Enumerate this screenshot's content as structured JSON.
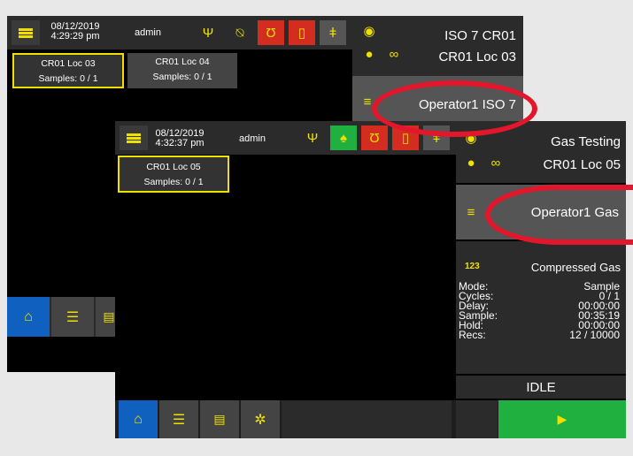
{
  "back_screen": {
    "header": {
      "date": "08/12/2019",
      "time": "4:29:29 pm",
      "user": "admin"
    },
    "locations": [
      {
        "name": "CR01 Loc 03",
        "samples": "Samples: 0 / 1"
      },
      {
        "name": "CR01 Loc 04",
        "samples": "Samples: 0 / 1"
      }
    ],
    "right_panel": {
      "line1": "ISO 7 CR01",
      "line2": "CR01 Loc 03",
      "operator": "Operator1 ISO 7"
    }
  },
  "front_screen": {
    "header": {
      "date": "08/12/2019",
      "time": "4:32:37 pm",
      "user": "admin"
    },
    "locations": [
      {
        "name": "CR01 Loc 05",
        "samples": "Samples: 0 / 1"
      }
    ],
    "right_panel": {
      "line1": "Gas Testing",
      "line2": "CR01 Loc 05",
      "operator": "Operator1 Gas",
      "counter_icon": "123",
      "type": "Compressed Gas",
      "stats": [
        {
          "label": "Mode:",
          "value": "Sample"
        },
        {
          "label": "Cycles:",
          "value": "0 / 1"
        },
        {
          "label": "Delay:",
          "value": "00:00:00"
        },
        {
          "label": "Sample:",
          "value": "00:35:19"
        },
        {
          "label": "Hold:",
          "value": "00:00:00"
        },
        {
          "label": "Recs:",
          "value": "12 / 10000"
        }
      ],
      "status": "IDLE"
    }
  },
  "colors": {
    "accent": "#f0e000",
    "alarm": "#d32d20",
    "ok": "#20b040",
    "highlight": "#e3162b",
    "nav_active": "#1060c0"
  }
}
